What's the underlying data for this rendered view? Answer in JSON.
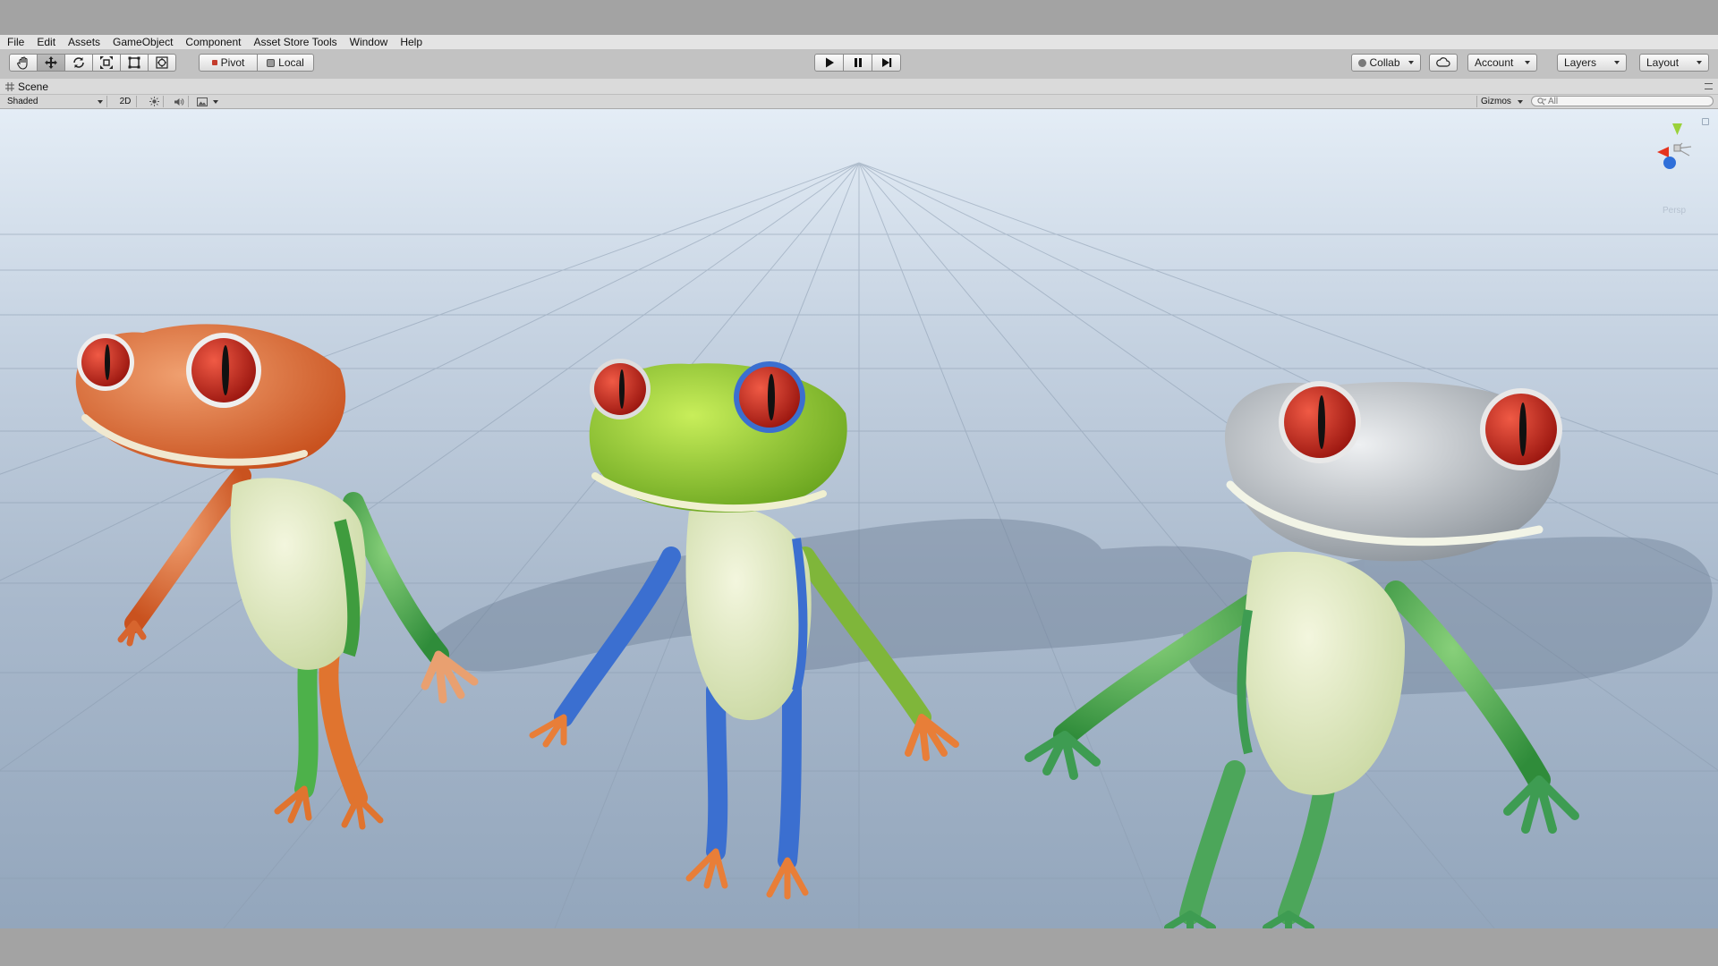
{
  "menu": [
    "File",
    "Edit",
    "Assets",
    "GameObject",
    "Component",
    "Asset Store Tools",
    "Window",
    "Help"
  ],
  "toolbar": {
    "tools": [
      "hand-tool",
      "move-tool",
      "rotate-tool",
      "scale-tool",
      "rect-tool",
      "transform-tool"
    ],
    "pivot_label": "Pivot",
    "local_label": "Local",
    "collab_label": "Collab",
    "account_label": "Account",
    "layers_label": "Layers",
    "layout_label": "Layout"
  },
  "scene": {
    "tab_label": "Scene",
    "shading_mode": "Shaded",
    "mode_2d_label": "2D",
    "gizmos_label": "Gizmos",
    "search_placeholder": "All",
    "view_label": "Persp"
  },
  "colors": {
    "frog_orange": "#e2703f",
    "frog_green": "#8cc63a",
    "frog_silver": "#b8bec4",
    "eye_red": "#c0241b",
    "gizmo_x": "#e6341f",
    "gizmo_y": "#9ad13a",
    "gizmo_z": "#2f6fd9"
  },
  "icons": [
    "hand-icon",
    "move-icon",
    "rotate-icon",
    "scale-icon",
    "rect-icon",
    "transform-icon",
    "play-icon",
    "pause-icon",
    "step-icon",
    "cloud-icon",
    "grid-icon",
    "sun-icon",
    "speaker-icon",
    "image-icon",
    "search-icon",
    "lock-icon"
  ]
}
